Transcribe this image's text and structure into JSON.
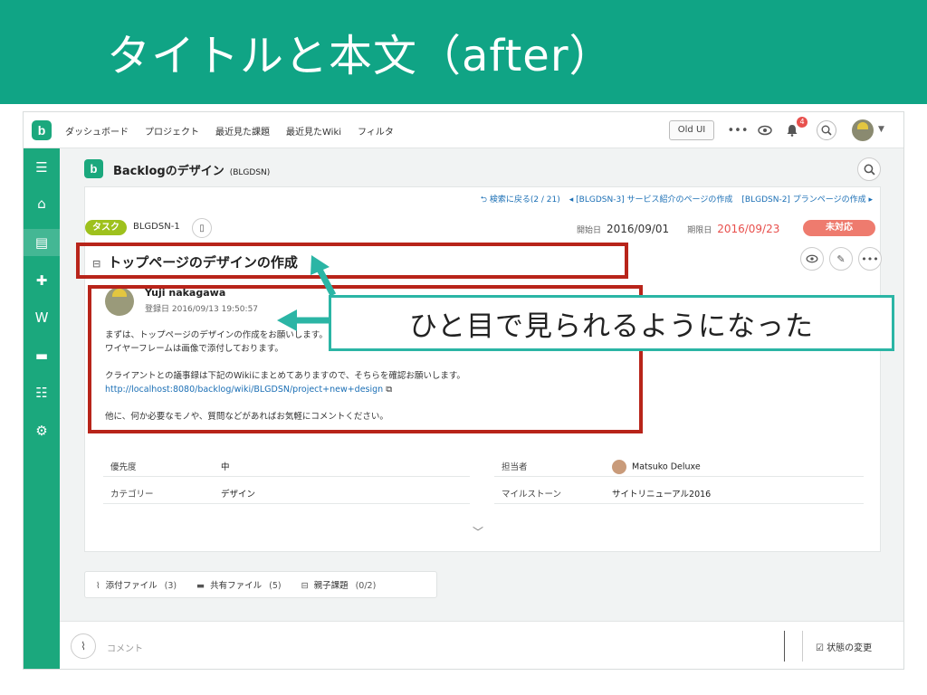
{
  "banner": {
    "title": "タイトルと本文（after）"
  },
  "header": {
    "nav": [
      "ダッシュボード",
      "プロジェクト",
      "最近見た課題",
      "最近見たWiki",
      "フィルタ"
    ],
    "old_ui": "Old UI",
    "notification_count": "4"
  },
  "project": {
    "name": "Backlogのデザイン",
    "key": "(BLGDSN)"
  },
  "breadcrumb": {
    "back": "⮌ 検索に戻る(2 / 21)",
    "prev": "◂ [BLGDSN-3] サービス紹介のページの作成",
    "next": "[BLGDSN-2] プランページの作成 ▸"
  },
  "issue": {
    "type": "タスク",
    "key": "BLGDSN-1",
    "start_label": "開始日",
    "start_date": "2016/09/01",
    "due_label": "期限日",
    "due_date": "2016/09/23",
    "status": "未対応",
    "title": "トップページのデザインの作成"
  },
  "description": {
    "author": "Yuji nakagawa",
    "date": "登録日 2016/09/13 19:50:57",
    "lines": [
      "まずは、トップページのデザインの作成をお願いします。",
      "ワイヤーフレームは画像で添付しております。",
      "",
      "クライアントとの議事録は下記のWikiにまとめてありますので、そちらを確認お願いします。",
      "",
      "他に、何か必要なモノや、質問などがあればお気軽にコメントください。"
    ],
    "link": "http://localhost:8080/backlog/wiki/BLGDSN/project+new+design"
  },
  "properties": {
    "priority_label": "優先度",
    "priority": "中",
    "category_label": "カテゴリー",
    "category": "デザイン",
    "assignee_label": "担当者",
    "assignee": "Matsuko Deluxe",
    "milestone_label": "マイルストーン",
    "milestone": "サイトリニューアル2016"
  },
  "tabs": [
    {
      "label": "添付ファイル",
      "count": "(3)"
    },
    {
      "label": "共有ファイル",
      "count": "(5)"
    },
    {
      "label": "親子課題",
      "count": "(0/2)"
    }
  ],
  "comment": {
    "placeholder": "コメント",
    "status_change": "状態の変更"
  },
  "callout": {
    "text": "ひと目で見られるようになった"
  },
  "colors": {
    "brand": "#10a485",
    "sidebar": "#1ba87d",
    "highlight": "#b8241a",
    "callout_border": "#2bb5a5",
    "due": "#e8504d",
    "status": "#ee7b6e",
    "task_tag": "#9ec11d"
  },
  "icons": [
    "logo-icon",
    "more-icon",
    "eye-icon",
    "bell-icon",
    "search-icon",
    "menu-icon",
    "home-icon",
    "issues-icon",
    "add-icon",
    "wiki-icon",
    "files-icon",
    "gantt-icon",
    "settings-icon",
    "help-icon",
    "clipboard-icon",
    "pencil-icon",
    "paperclip-icon",
    "chevron-down-icon",
    "edit-status-icon",
    "parent-child-icon"
  ]
}
